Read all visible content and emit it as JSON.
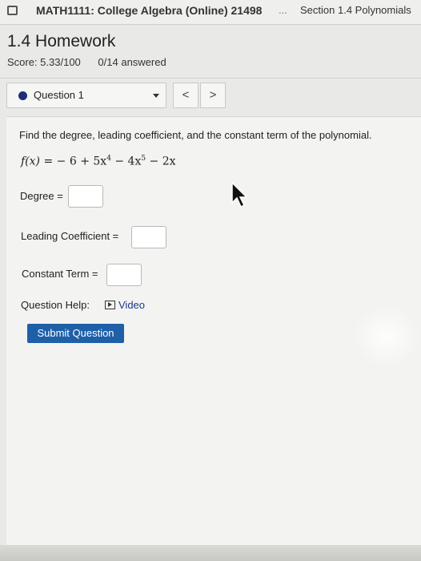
{
  "topbar": {
    "course_title": "MATH1111: College Algebra (Online) 21498",
    "more": "...",
    "section": "Section 1.4 Polynomials"
  },
  "homework": {
    "title": "1.4 Homework",
    "score": "Score: 5.33/100",
    "answered": "0/14 answered"
  },
  "question_nav": {
    "selected": "Question 1",
    "prev_label": "<",
    "next_label": ">"
  },
  "question": {
    "prompt": "Find the degree, leading coefficient, and the constant term of the polynomial.",
    "formula": {
      "lhs": "f(x)",
      "eq": " = ",
      "t1": " − 6 + 5x",
      "e1": "4",
      "t2": " − 4x",
      "e2": "5",
      "t3": " − 2x"
    },
    "fields": {
      "degree_label": "Degree =",
      "leading_label": "Leading Coefficient =",
      "constant_label": "Constant Term ="
    },
    "help_label": "Question Help:",
    "video_label": "Video",
    "submit_label": "Submit Question"
  },
  "colors": {
    "accent": "#1e5fa8",
    "status_dot": "#1b2f7a"
  }
}
